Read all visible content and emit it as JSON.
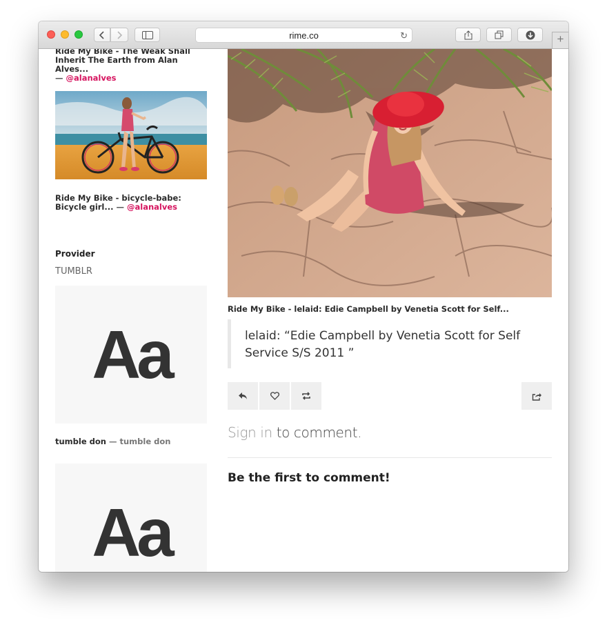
{
  "browser": {
    "url": "rime.co"
  },
  "sidebar": {
    "post1": {
      "title": "Ride My Bike - The Weak Shall Inherit The Earth from Alan Alves...",
      "dash": "—",
      "author": "@alanalves"
    },
    "post2": {
      "title": "Ride My Bike - bicycle-babe: Bicycle girl...",
      "dash": "—",
      "author": "@alanalves"
    },
    "provider_label": "Provider",
    "provider_value": "TUMBLR",
    "font_sample_1": "Aa",
    "post3": {
      "title": "tumble don",
      "dash": "—",
      "author": "tumble don"
    },
    "font_sample_2": "Aa"
  },
  "main": {
    "caption": "Ride My Bike - lelaid: Edie Campbell by Venetia Scott for Self...",
    "quote": "lelaid: “Edie Campbell by Venetia Scott for Self Service S/S 2011 ”",
    "actions": {
      "reply_icon": "reply-icon",
      "like_icon": "heart-icon",
      "repost_icon": "repost-icon",
      "share_icon": "share-icon"
    },
    "signin_link": "Sign in",
    "signin_rest": " to comment.",
    "empty_comments": "Be the first to comment!"
  },
  "colors": {
    "author_accent": "#d6145f",
    "button_bg": "#efefef"
  }
}
